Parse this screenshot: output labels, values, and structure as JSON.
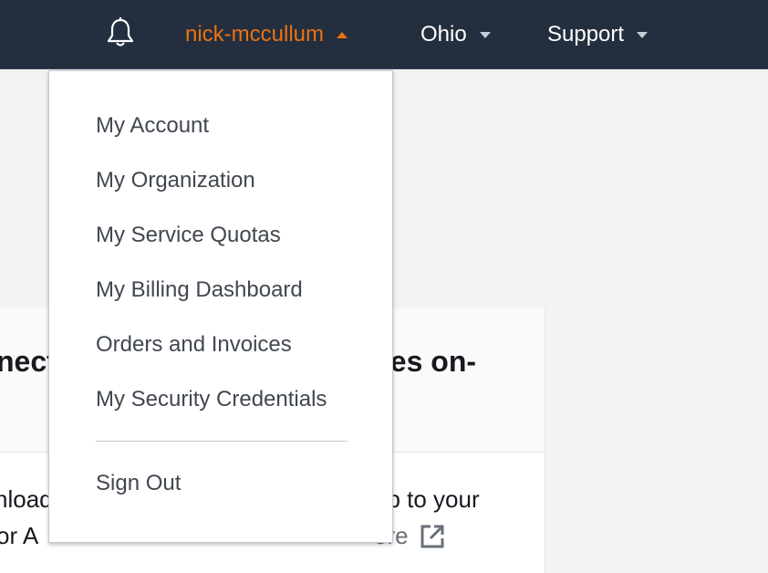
{
  "topbar": {
    "notifications_icon": "bell-icon",
    "user_menu_label": "nick-mccullum",
    "region_label": "Ohio",
    "support_label": "Support",
    "colors": {
      "background": "#232f3e",
      "accent": "#ec7211",
      "text": "#ffffff"
    }
  },
  "account_menu": {
    "items": [
      {
        "label": "My Account"
      },
      {
        "label": "My Organization"
      },
      {
        "label": "My Service Quotas"
      },
      {
        "label": "My Billing Dashboard"
      },
      {
        "label": "Orders and Invoices"
      },
      {
        "label": "My Security Credentials"
      }
    ],
    "sign_out_label": "Sign Out"
  },
  "background_panel": {
    "heading_left_fragment": "nect",
    "heading_right_fragment": "ces on-",
    "body_left_line1": "nload",
    "body_left_line2": "or A",
    "body_right_line1": "op to your",
    "body_right_line2": "ore",
    "external_link_icon": "external-link-icon"
  }
}
